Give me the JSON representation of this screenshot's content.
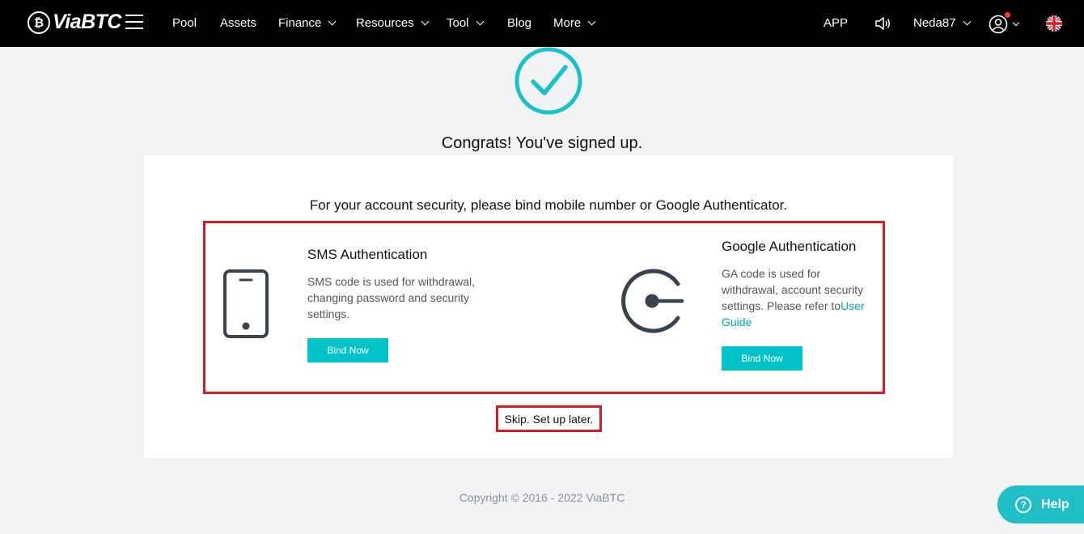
{
  "brand": {
    "name": "ViaBTC",
    "mark": "₿"
  },
  "nav": {
    "items": [
      {
        "label": "Pool",
        "has_dropdown": false
      },
      {
        "label": "Assets",
        "has_dropdown": false
      },
      {
        "label": "Finance",
        "has_dropdown": true
      },
      {
        "label": "Resources",
        "has_dropdown": true
      },
      {
        "label": "Tool",
        "has_dropdown": true
      },
      {
        "label": "Blog",
        "has_dropdown": false
      },
      {
        "label": "More",
        "has_dropdown": true
      }
    ],
    "app_label": "APP",
    "username": "Neda87",
    "icons": [
      "menu-icon",
      "speaker-icon",
      "user-icon",
      "uk-flag-icon"
    ]
  },
  "main": {
    "success_icon": "checkmark-circle-icon",
    "congrats": "Congrats! You've signed up.",
    "security_message": "For your account security, please bind mobile number or Google Authenticator.",
    "sms": {
      "icon": "phone-icon",
      "title": "SMS Authentication",
      "description": "SMS code is used for withdrawal, changing password and security settings.",
      "button": "Bind Now"
    },
    "google": {
      "icon": "authenticator-icon",
      "title": "Google Authentication",
      "description": "GA code is used for withdrawal, account security settings. Please refer to",
      "link": "User Guide",
      "button": "Bind Now"
    },
    "skip": "Skip. Set up later."
  },
  "footer": {
    "copyright": "Copyright © 2016 - 2022 ViaBTC"
  },
  "help": {
    "label": "Help",
    "glyph": "?"
  },
  "colors": {
    "accent": "#00c3c8",
    "highlight": "#d21f26",
    "topbar": "#000000",
    "background": "#f2f3f5"
  }
}
